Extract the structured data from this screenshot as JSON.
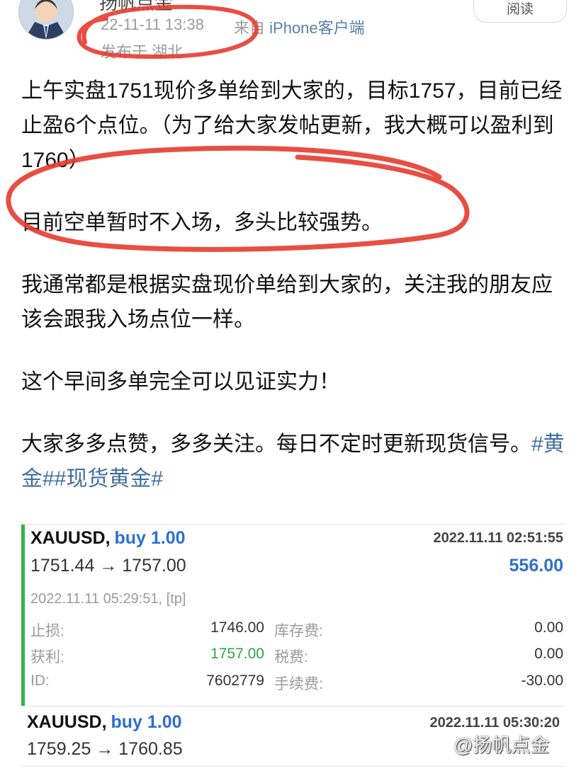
{
  "header": {
    "author": "扬帆点金",
    "time": "22-11-11 13:38",
    "source_prefix": "来自",
    "source_client": "iPhone客户端",
    "location": "发布于 湖北",
    "read_label": "阅读"
  },
  "post": {
    "p1": "上午实盘1751现价多单给到大家的，目标1757，目前已经止盈6个点位。（为了给大家发帖更新，我大概可以盈利到1760）",
    "p2": "目前空单暂时不入场，多头比较强势。",
    "p3": "我通常都是根据实盘现价单给到大家的，关注我的朋友应该会跟我入场点位一样。",
    "p4": "这个早间多单完全可以见证实力！",
    "p5_text": "大家多多点赞，多多关注。每日不定时更新现货信号。",
    "hashtags": "#黄金##现货黄金#"
  },
  "trades": [
    {
      "symbol": "XAUUSD,",
      "side": "buy 1.00",
      "open_time": "2022.11.11 02:51:55",
      "prices": "1751.44 → 1757.00",
      "profit": "556.00",
      "close_time": "2022.11.11 05:29:51, [tp]",
      "sl_label": "止损:",
      "sl_value": "1746.00",
      "tp_label": "获利:",
      "tp_value": "1757.00",
      "id_label": "ID:",
      "id_value": "7602779",
      "swap_label": "库存费:",
      "swap_value": "0.00",
      "tax_label": "税费:",
      "tax_value": "0.00",
      "fee_label": "手续费:",
      "fee_value": "-30.00"
    },
    {
      "symbol": "XAUUSD,",
      "side": "buy 1.00",
      "open_time": "2022.11.11 05:30:20",
      "prices": "1759.25 → 1760.85"
    }
  ],
  "watermark": "@扬帆点金",
  "colors": {
    "accent_blue": "#2c6fd0",
    "profit_green": "#2fa83e",
    "annotation_red": "#e63b2e",
    "hashtag_blue": "#3f6ea3"
  }
}
